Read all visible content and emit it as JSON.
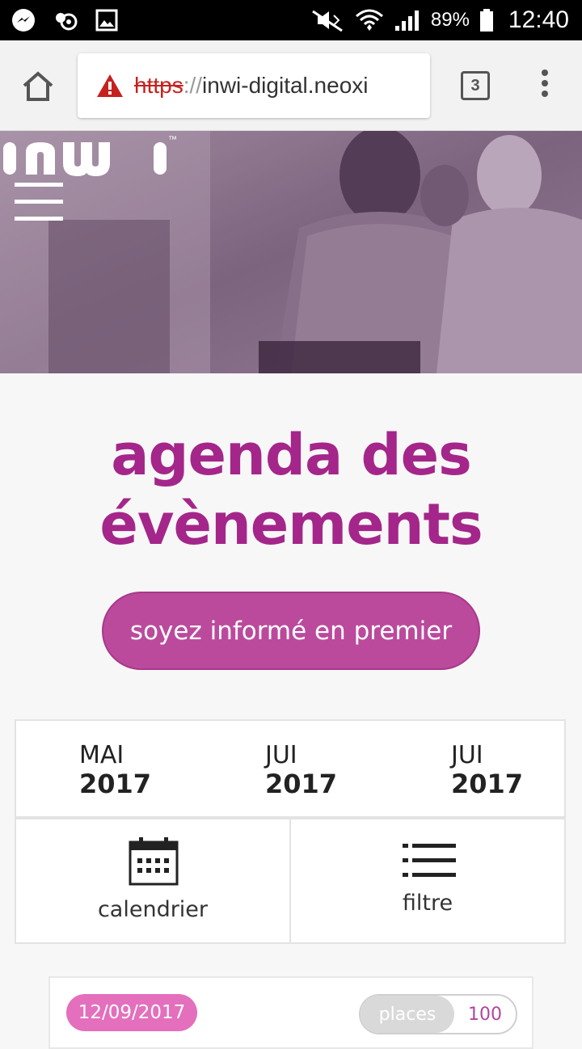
{
  "status_bar": {
    "battery": "89%",
    "time": "12:40",
    "icons": [
      "messenger-icon",
      "chat-bubble-icon",
      "gallery-icon",
      "mute-icon",
      "wifi-icon",
      "signal-icon",
      "battery-icon"
    ]
  },
  "browser": {
    "url_scheme": "https",
    "url_separator": "://",
    "url_host": "inwi-digital.neoxi",
    "tab_count": "3"
  },
  "hero": {
    "logo_text": "inwi",
    "logo_mark": "™"
  },
  "main": {
    "title_line1": "agenda des",
    "title_line2": "évènements",
    "cta_label": "soyez informé en premier",
    "months": [
      {
        "month": "MAI",
        "year": "2017"
      },
      {
        "month": "JUI",
        "year": "2017"
      },
      {
        "month": "JUI",
        "year": "2017"
      }
    ],
    "calendar_label": "calendrier",
    "filter_label": "filtre"
  },
  "event": {
    "date": "12/09/2017",
    "places_label": "places",
    "places_count": "100"
  },
  "colors": {
    "brand_magenta": "#a4268a",
    "cta_bg": "#bb4a9d",
    "badge_pink": "#e46fbd",
    "warning_red": "#c5221f"
  }
}
